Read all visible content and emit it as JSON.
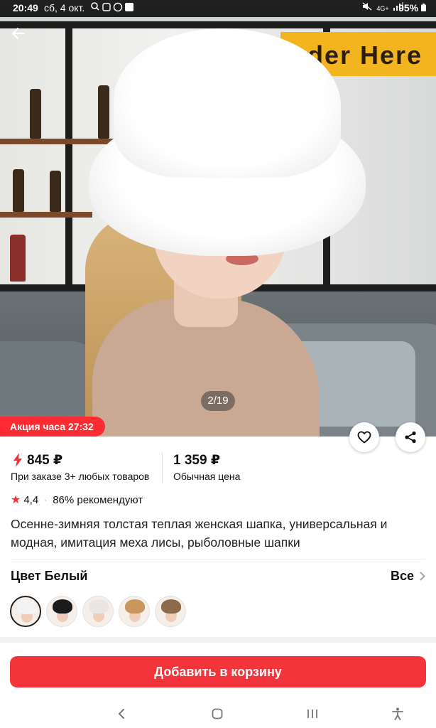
{
  "status_bar": {
    "time": "20:49",
    "date": "сб, 4 окт.",
    "network": "4G+",
    "battery": "95%"
  },
  "gallery": {
    "counter": "2/19",
    "sign_text": "der Here"
  },
  "promo": {
    "label": "Акция часа 27:32"
  },
  "price": {
    "sale": "845 ₽",
    "sale_note": "При заказе 3+ любых товаров",
    "regular": "1 359 ₽",
    "regular_note": "Обычная цена"
  },
  "rating": {
    "score": "4,4",
    "recommend": "86% рекомендуют"
  },
  "product": {
    "title": "Осенне-зимняя толстая теплая женская шапка, универсальная и модная, имитация меха лисы, рыболовные шапки"
  },
  "color": {
    "label": "Цвет Белый",
    "all_label": "Все",
    "swatches": [
      {
        "hat": "#f4f4f4",
        "selected": true
      },
      {
        "hat": "#1b1b1b",
        "selected": false
      },
      {
        "hat": "#e9e6e3",
        "selected": false
      },
      {
        "hat": "#c9965e",
        "selected": false
      },
      {
        "hat": "#8c6a4a",
        "selected": false
      }
    ]
  },
  "cart": {
    "button_label": "Добавить в корзину"
  },
  "colors": {
    "accent": "#f4343b",
    "promo": "#ff2b33"
  }
}
